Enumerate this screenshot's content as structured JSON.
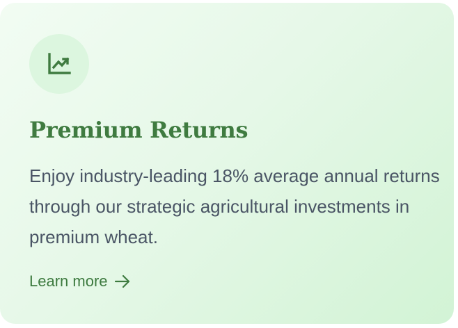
{
  "card": {
    "icon": "trending-up-chart-icon",
    "title": "Premium Returns",
    "description": "Enjoy industry-leading 18% average annual returns through our strategic agricultural investments in premium wheat.",
    "link_label": "Learn more",
    "link_icon": "arrow-right-icon"
  },
  "colors": {
    "accent": "#3f7b40",
    "body_text": "#4a5565",
    "icon_bg": "#dcf6df",
    "card_bg_start": "#f2fcf3",
    "card_bg_end": "#d2f3d5"
  }
}
